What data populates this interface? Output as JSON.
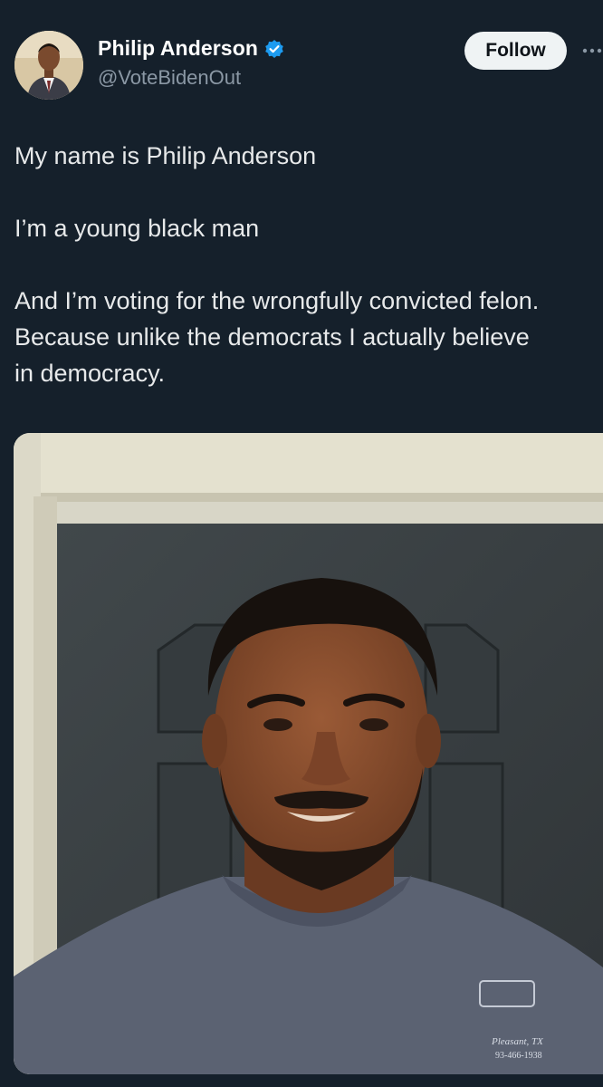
{
  "tweet": {
    "author": {
      "display_name": "Philip Anderson",
      "handle": "@VoteBidenOut",
      "verified": true,
      "avatar": "profile-photo-man-in-suit"
    },
    "follow_label": "Follow",
    "more_icon": "more-horizontal-icon",
    "text_paragraphs": [
      "My name is Philip Anderson",
      "I’m a young black man",
      "And I’m voting for the wrongfully convicted felon.\nBecause unlike the democrats I actually believe\nin democracy."
    ],
    "text": {
      "p1": "My name is Philip Anderson",
      "p2": "I’m a young black man",
      "p3_line1": "And I’m voting for the wrongfully convicted felon.",
      "p3_line2": "Because unlike the democrats I actually believe",
      "p3_line3": "in democracy."
    },
    "media": {
      "description_icon": "photo-selfie-man-in-front-of-door",
      "shirt_print": {
        "line1": "Pleasant, TX",
        "line2": "93-466-1938"
      }
    }
  },
  "colors": {
    "background": "#15202b",
    "text": "#e7e9ea",
    "secondary_text": "#8b98a5",
    "verified_badge": "#1d9bf0",
    "follow_button_bg": "#eff3f4",
    "follow_button_text": "#0f1419"
  }
}
